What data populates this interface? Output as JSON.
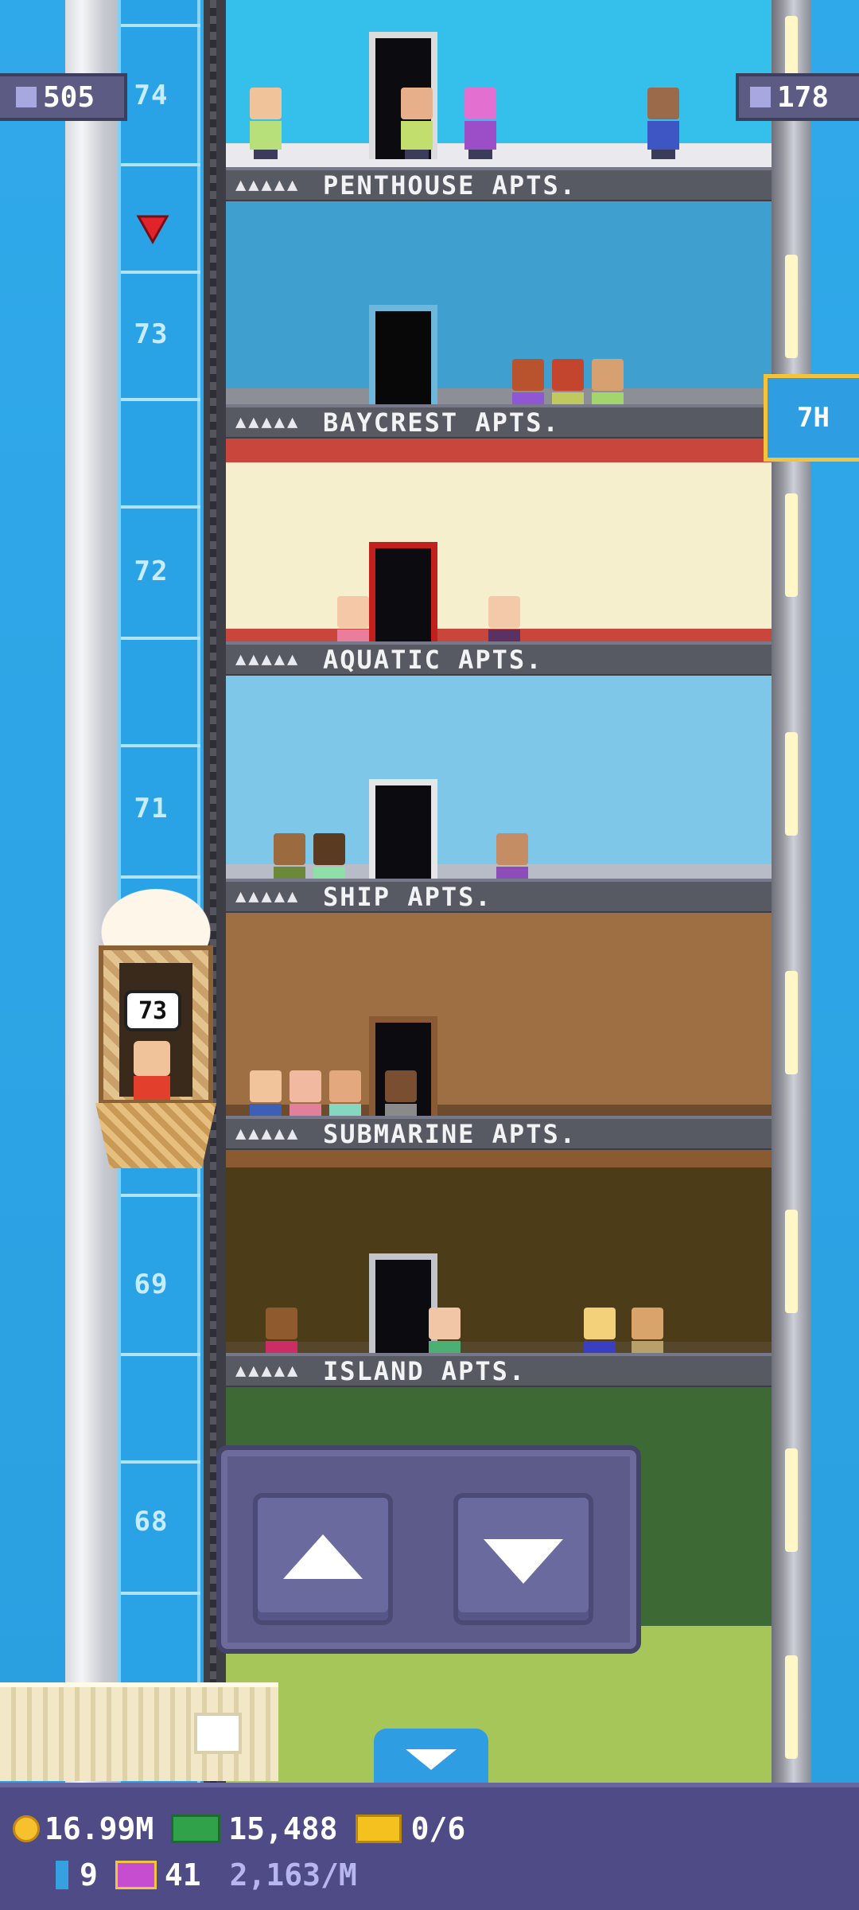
{
  "hud_top": {
    "population": "505",
    "stories": "178"
  },
  "vip_button": {
    "label": "7H"
  },
  "shaft": {
    "floor_numbers": [
      "74",
      "73",
      "72",
      "71",
      "69",
      "68"
    ]
  },
  "elevator": {
    "current_floor": "73"
  },
  "floors": [
    {
      "stars": "▲▲▲▲▲",
      "name": "PENTHOUSE APTS.",
      "wall": "#34c0ea",
      "floor": "#e9e9ee"
    },
    {
      "stars": "▲▲▲▲▲",
      "name": "BAYCREST APTS.",
      "wall": "#3f9fcf",
      "floor": "#8d8f97"
    },
    {
      "stars": "▲▲▲▲▲",
      "name": "AQUATIC APTS.",
      "wall": "#f6efce",
      "floor": "#c9463c"
    },
    {
      "stars": "▲▲▲▲▲",
      "name": "SHIP APTS.",
      "wall": "#7fc7e8",
      "floor": "#b7bcc6"
    },
    {
      "stars": "▲▲▲▲▲",
      "name": "SUBMARINE APTS.",
      "wall": "#9d6f42",
      "floor": "#6e4b2c"
    },
    {
      "stars": "▲▲▲▲▲",
      "name": "ISLAND APTS.",
      "wall": "#4c3c18",
      "floor": "#57472a"
    }
  ],
  "hud_bottom": {
    "coins": "16.99M",
    "bux": "15,488",
    "tickets": "0/6",
    "fuel": "9",
    "gems": "41",
    "coin_rate": "2,163/M"
  },
  "icons": {
    "population": "person-icon",
    "stories": "building-icon",
    "coins": "coin-icon",
    "bux": "tower-bux-icon",
    "tickets": "golden-ticket-icon",
    "fuel": "elevator-fuel-icon",
    "gems": "gem-icon"
  }
}
